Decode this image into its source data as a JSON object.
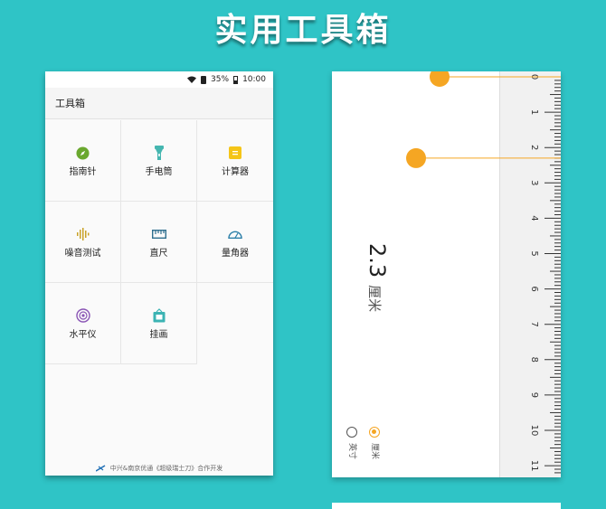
{
  "banner": {
    "title": "实用工具箱"
  },
  "phone1": {
    "status": {
      "battery_text": "35%",
      "time": "10:00"
    },
    "appbar": {
      "title": "工具箱"
    },
    "tools": [
      {
        "label": "指南针",
        "icon": "compass-icon",
        "color": "#6aa82e"
      },
      {
        "label": "手电筒",
        "icon": "flashlight-icon",
        "color": "#45b6b0"
      },
      {
        "label": "计算器",
        "icon": "calculator-icon",
        "color": "#f5c518"
      },
      {
        "label": "噪音测试",
        "icon": "sound-wave-icon",
        "color": "#c9a227"
      },
      {
        "label": "直尺",
        "icon": "ruler-icon",
        "color": "#2f6f8f"
      },
      {
        "label": "量角器",
        "icon": "protractor-icon",
        "color": "#2b7fa8"
      },
      {
        "label": "水平仪",
        "icon": "level-icon",
        "color": "#8a55b5"
      },
      {
        "label": "挂画",
        "icon": "picture-frame-icon",
        "color": "#3bb3b3"
      }
    ],
    "footer": "中兴&南京优通《超级瑞士刀》合作开发"
  },
  "phone2": {
    "reading": {
      "value": "2.3",
      "unit": "厘米"
    },
    "unit_options": [
      {
        "label": "厘米",
        "selected": true
      },
      {
        "label": "英寸",
        "selected": false
      }
    ],
    "ruler_numbers": [
      "0",
      "1",
      "2",
      "3",
      "4",
      "5",
      "6",
      "7",
      "8",
      "9",
      "10",
      "11"
    ],
    "markers_cm": [
      0,
      2.3
    ],
    "accent": "#f5a623"
  }
}
